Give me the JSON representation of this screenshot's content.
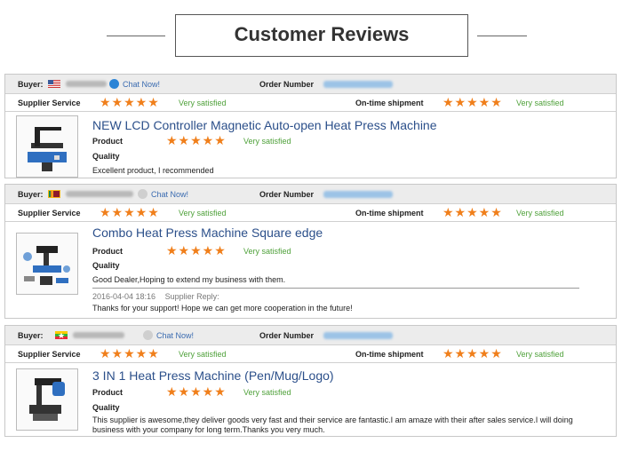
{
  "page": {
    "title": "Customer Reviews"
  },
  "labels": {
    "buyer": "Buyer:",
    "order_number": "Order Number",
    "supplier_service": "Supplier Service",
    "on_time_shipment": "On-time shipment",
    "product": "Product",
    "quality": "Quality",
    "chat": "Chat Now!"
  },
  "colors": {
    "stars": "#f07f1b",
    "satisfied": "#4fa13a",
    "product_title": "#2b4f8a",
    "chat_link": "#3a6bb0"
  },
  "reviews": [
    {
      "buyer_flag": "us-flag-icon",
      "chat_label": "Chat Now!",
      "supplier_service_stars": 5,
      "supplier_service_text": "Very satisfied",
      "on_time_stars": 5,
      "on_time_text": "Very satisfied",
      "product_title": "NEW LCD Controller Magnetic Auto-open Heat Press Machine",
      "product_stars": 5,
      "product_text": "Very satisfied",
      "comment": "Excellent product, I recommended"
    },
    {
      "buyer_flag": "sri-lanka-flag-icon",
      "chat_label": "Chat Now!",
      "supplier_service_stars": 5,
      "supplier_service_text": "Very satisfied",
      "on_time_stars": 5,
      "on_time_text": "Very satisfied",
      "product_title": "Combo Heat Press Machine Square edge",
      "product_stars": 5,
      "product_text": "Very satisfied",
      "comment": "Good Dealer,Hoping to extend my business with them.",
      "reply_date": "2016-04-04   18:16",
      "reply_label": "Supplier Reply:",
      "reply_text": "Thanks for your support! Hope we can get more cooperation in the future!"
    },
    {
      "buyer_flag": "myanmar-flag-icon",
      "chat_label": "Chat Now!",
      "supplier_service_stars": 5,
      "supplier_service_text": "Very satisfied",
      "on_time_stars": 5,
      "on_time_text": "Very satisfied",
      "product_title": "3 IN 1 Heat Press Machine (Pen/Mug/Logo)",
      "product_stars": 5,
      "product_text": "Very satisfied",
      "comment": "This supplier is awesome,they deliver goods very fast and their service are fantastic.I am amaze with their after sales service.I will doing business with your company for long term.Thanks you very much."
    }
  ]
}
